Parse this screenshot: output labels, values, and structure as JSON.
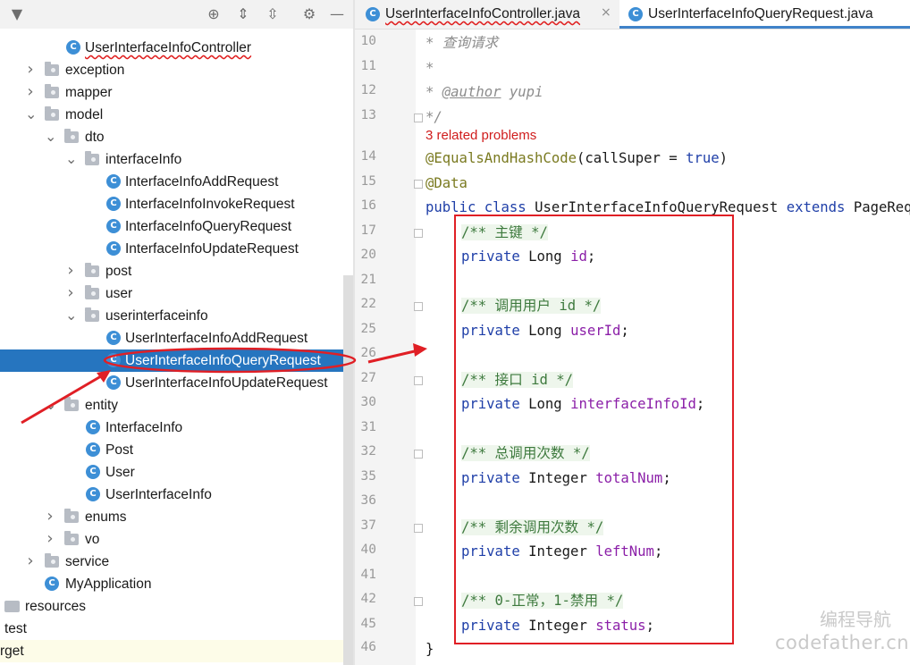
{
  "project_tree": {
    "rows": [
      {
        "label": "UserInterfaceInfoController",
        "kind": "class",
        "squiggle": true,
        "chev": ""
      },
      {
        "label": "exception",
        "kind": "folder",
        "chev": "right"
      },
      {
        "label": "mapper",
        "kind": "folder",
        "chev": "right"
      },
      {
        "label": "model",
        "kind": "folder",
        "chev": "down"
      },
      {
        "label": "dto",
        "kind": "folder",
        "chev": "down"
      },
      {
        "label": "interfaceInfo",
        "kind": "folder",
        "chev": "down"
      },
      {
        "label": "InterfaceInfoAddRequest",
        "kind": "class",
        "chev": ""
      },
      {
        "label": "InterfaceInfoInvokeRequest",
        "kind": "class",
        "chev": ""
      },
      {
        "label": "InterfaceInfoQueryRequest",
        "kind": "class",
        "chev": ""
      },
      {
        "label": "InterfaceInfoUpdateRequest",
        "kind": "class",
        "chev": ""
      },
      {
        "label": "post",
        "kind": "folder",
        "chev": "right"
      },
      {
        "label": "user",
        "kind": "folder",
        "chev": "right"
      },
      {
        "label": "userinterfaceinfo",
        "kind": "folder",
        "chev": "down"
      },
      {
        "label": "UserInterfaceInfoAddRequest",
        "kind": "class",
        "chev": ""
      },
      {
        "label": "UserInterfaceInfoQueryRequest",
        "kind": "class",
        "chev": "",
        "selected": true
      },
      {
        "label": "UserInterfaceInfoUpdateRequest",
        "kind": "class",
        "chev": ""
      },
      {
        "label": "entity",
        "kind": "folder",
        "chev": "down"
      },
      {
        "label": "InterfaceInfo",
        "kind": "class",
        "chev": ""
      },
      {
        "label": "Post",
        "kind": "class",
        "chev": ""
      },
      {
        "label": "User",
        "kind": "class",
        "chev": ""
      },
      {
        "label": "UserInterfaceInfo",
        "kind": "class",
        "chev": ""
      },
      {
        "label": "enums",
        "kind": "folder",
        "chev": "right"
      },
      {
        "label": "vo",
        "kind": "folder",
        "chev": "right"
      },
      {
        "label": "service",
        "kind": "folder",
        "chev": "right"
      },
      {
        "label": "MyApplication",
        "kind": "app",
        "chev": ""
      },
      {
        "label": "resources",
        "kind": "plainfolder",
        "chev": ""
      },
      {
        "label": "test",
        "kind": "none",
        "chev": ""
      },
      {
        "label": "rget",
        "kind": "none",
        "chev": "",
        "highlighted": true
      }
    ]
  },
  "tabs": [
    {
      "label": "UserInterfaceInfoController.java",
      "active": false,
      "close": "×"
    },
    {
      "label": "UserInterfaceInfoQueryRequest.java",
      "active": true
    }
  ],
  "editor": {
    "line_numbers": [
      "10",
      "11",
      "12",
      "13",
      "14",
      "15",
      "16",
      "17",
      "20",
      "21",
      "22",
      "25",
      "26",
      "27",
      "30",
      "31",
      "32",
      "35",
      "36",
      "37",
      "40",
      "41",
      "42",
      "45",
      "46"
    ],
    "problems_text": "3 related problems",
    "lines": {
      "l10": "* 查询请求",
      "l11": "*",
      "l12_star": "* ",
      "l12_tag": "@author",
      "l12_name": " yupi",
      "l13": "*/",
      "l14_ann": "@EqualsAndHashCode",
      "l14_rest": "(callSuper = ",
      "l14_true": "true",
      "l14_end": ")",
      "l15": "@Data",
      "l16_kw1": "public class ",
      "l16_name": "UserInterfaceInfoQueryRequest ",
      "l16_kw2": "extends ",
      "l16_base": "PageRequest",
      "c17": "/** 主键 */",
      "c22": "/** 调用用户 id */",
      "c27": "/** 接口 id */",
      "c32": "/** 总调用次数 */",
      "c37": "/** 剩余调用次数 */",
      "c42": "/** 0-正常，1-禁用 */",
      "kw_private": "private ",
      "type_long": "Long ",
      "type_integer": "Integer ",
      "f_id": "id",
      "f_userId": "userId",
      "f_interfaceInfoId": "interfaceInfoId",
      "f_totalNum": "totalNum",
      "f_leftNum": "leftNum",
      "f_status": "status",
      "semi": ";",
      "close_brace": "}"
    }
  },
  "watermark": {
    "line1": "编程导航",
    "line2": "codefather.cn"
  },
  "colors": {
    "annotation_red": "#e01f25",
    "selection_blue": "#2675bf"
  },
  "toolbar_icons": [
    "locate-icon",
    "expand-all-icon",
    "collapse-all-icon",
    "settings-icon",
    "minimize-icon"
  ]
}
